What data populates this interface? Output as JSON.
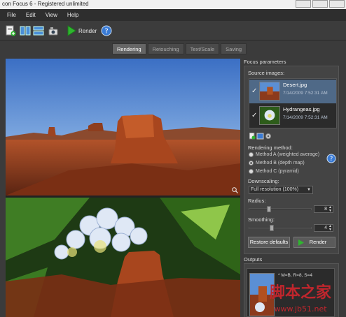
{
  "window": {
    "title": "con Focus 6 - Registered unlimited"
  },
  "menu": [
    "File",
    "Edit",
    "View",
    "Help"
  ],
  "toolbar": {
    "render_label": "Render"
  },
  "tabs": [
    {
      "label": "Rendering",
      "active": true
    },
    {
      "label": "Retouching",
      "active": false
    },
    {
      "label": "Text/Scale",
      "active": false
    },
    {
      "label": "Saving",
      "active": false
    }
  ],
  "panel": {
    "focus_heading": "Focus parameters",
    "source_heading": "Source images:",
    "sources": [
      {
        "name": "Desert.jpg",
        "date": "7/14/2009 7:52:31 AM",
        "checked": true,
        "selected": true
      },
      {
        "name": "Hydrangeas.jpg",
        "date": "7/14/2009 7:52:31 AM",
        "checked": true,
        "selected": false
      }
    ],
    "method_heading": "Rendering method:",
    "methods": [
      {
        "label": "Method A (weighted average)",
        "selected": false
      },
      {
        "label": "Method B (depth map)",
        "selected": true
      },
      {
        "label": "Method C (pyramid)",
        "selected": false
      }
    ],
    "downscaling_label": "Downscaling:",
    "downscaling_value": "Full resolution (100%)",
    "radius_label": "Radius:",
    "radius_value": "8",
    "radius_level": 0.3,
    "smoothing_label": "Smoothing:",
    "smoothing_value": "4",
    "smoothing_level": 0.35,
    "restore_label": "Restore defaults",
    "render_label": "Render",
    "outputs_heading": "Outputs",
    "output_text": "* M=B, R=8, S=4"
  },
  "watermark": {
    "text": "脚本之家",
    "url": "www.jb51.net"
  },
  "colors": {
    "accent": "#4f6987",
    "render_green": "#2fb52f",
    "help_blue": "#3a7bd5"
  }
}
